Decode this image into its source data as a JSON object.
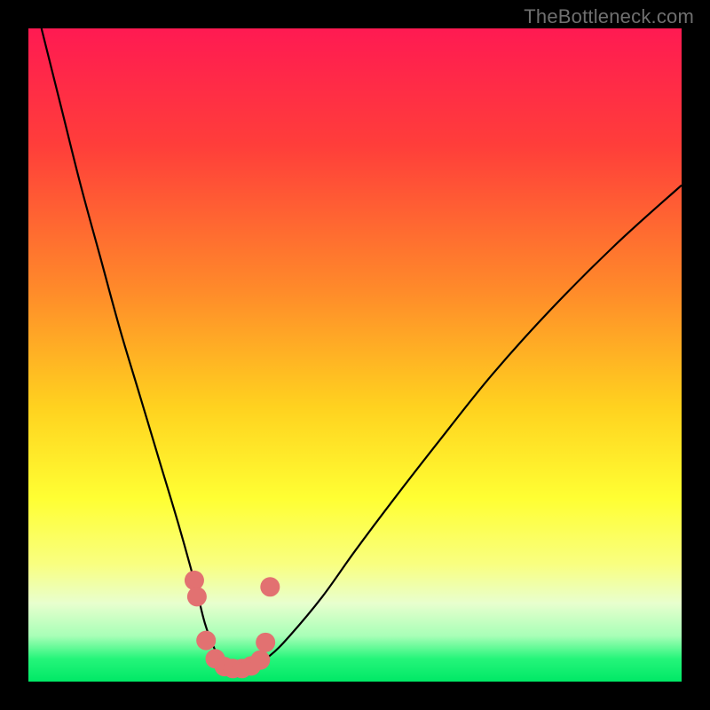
{
  "watermark": "TheBottleneck.com",
  "chart_data": {
    "type": "line",
    "title": "",
    "xlabel": "",
    "ylabel": "",
    "xlim": [
      0,
      100
    ],
    "ylim": [
      0,
      100
    ],
    "background_gradient": [
      {
        "stop": 0.0,
        "color": "#ff1a52"
      },
      {
        "stop": 0.18,
        "color": "#ff3e3a"
      },
      {
        "stop": 0.4,
        "color": "#ff8a2a"
      },
      {
        "stop": 0.58,
        "color": "#ffd21f"
      },
      {
        "stop": 0.72,
        "color": "#ffff33"
      },
      {
        "stop": 0.82,
        "color": "#f9ff80"
      },
      {
        "stop": 0.88,
        "color": "#e8ffce"
      },
      {
        "stop": 0.93,
        "color": "#a8ffb7"
      },
      {
        "stop": 0.965,
        "color": "#25f57a"
      },
      {
        "stop": 1.0,
        "color": "#00e866"
      }
    ],
    "series": [
      {
        "name": "bottleneck-curve",
        "type": "line",
        "x": [
          2,
          5,
          8,
          11,
          14,
          17,
          20,
          23,
          25.5,
          27,
          28.5,
          30,
          32,
          34.5,
          37,
          40,
          45,
          50,
          56,
          63,
          71,
          80,
          90,
          100
        ],
        "y": [
          100,
          88,
          76,
          65,
          54,
          44,
          34,
          24,
          15,
          9,
          5,
          2.5,
          2,
          2.5,
          4,
          7,
          13,
          20,
          28,
          37,
          47,
          57,
          67,
          76
        ]
      },
      {
        "name": "bottleneck-markers",
        "type": "scatter",
        "color": "#e27171",
        "x": [
          25.4,
          25.8,
          27.2,
          28.6,
          30.0,
          31.3,
          32.7,
          34.1,
          35.5,
          36.3,
          37.0
        ],
        "y": [
          15.5,
          13.0,
          6.3,
          3.5,
          2.3,
          2.0,
          2.0,
          2.4,
          3.3,
          6.0,
          14.5
        ]
      }
    ]
  }
}
